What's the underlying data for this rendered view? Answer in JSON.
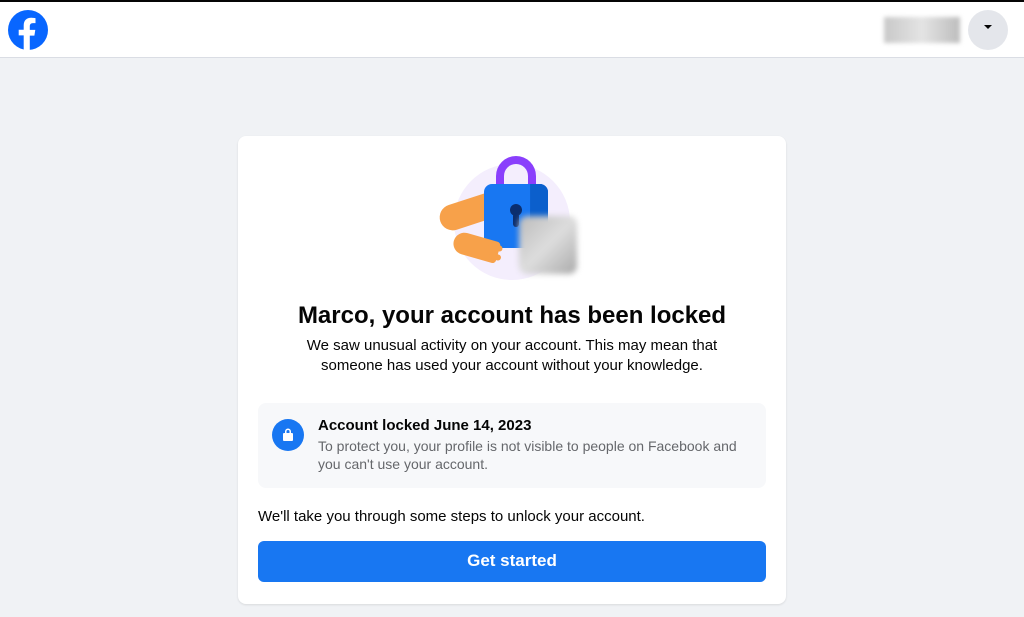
{
  "header": {
    "logo": "facebook-logo"
  },
  "card": {
    "title": "Marco, your account has been locked",
    "subtitle": "We saw unusual activity on your account. This may mean that someone has used your account without your knowledge.",
    "notice": {
      "title": "Account locked June 14, 2023",
      "description": "To protect you, your profile is not visible to people on Facebook and you can't use your account."
    },
    "steps_text": "We'll take you through some steps to unlock your account.",
    "cta_label": "Get started"
  }
}
